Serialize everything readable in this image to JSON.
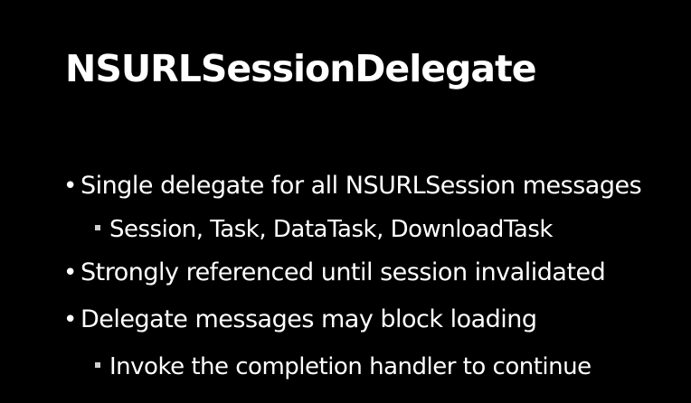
{
  "slide": {
    "title": "NSURLSessionDelegate",
    "bullets": [
      {
        "level": 1,
        "marker": "•",
        "text": "Single delegate for all NSURLSession messages"
      },
      {
        "level": 2,
        "marker": "▪",
        "text": "Session, Task, DataTask, DownloadTask"
      },
      {
        "level": 1,
        "marker": "•",
        "text": "Strongly referenced until session invalidated"
      },
      {
        "level": 1,
        "marker": "•",
        "text": "Delegate messages may block loading"
      },
      {
        "level": 2,
        "marker": "▪",
        "text": "Invoke the completion handler to continue"
      }
    ]
  },
  "colors": {
    "background": "#000000",
    "text": "#ffffff",
    "sub_bullet": "#cfcfcf"
  }
}
